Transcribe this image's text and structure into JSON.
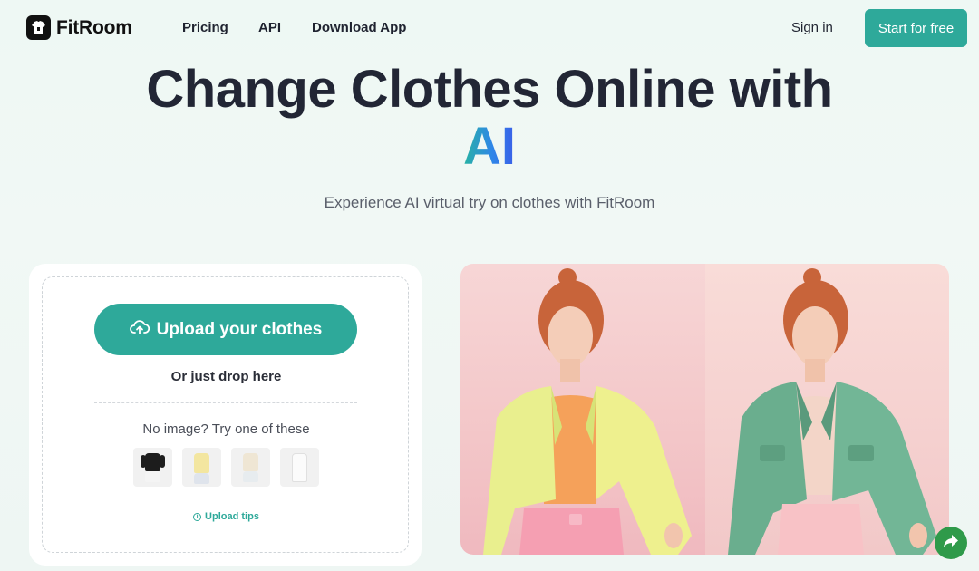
{
  "brand": {
    "name": "FitRoom"
  },
  "nav": {
    "links": [
      "Pricing",
      "API",
      "Download App"
    ],
    "sign_in": "Sign in",
    "cta": "Start for free"
  },
  "hero": {
    "title_line1": "Change Clothes Online with",
    "title_line2": "AI",
    "subtitle": "Experience AI virtual try on clothes with FitRoom"
  },
  "upload": {
    "button_label": "Upload your clothes",
    "drop_text": "Or just drop here",
    "samples_text": "No image? Try one of these",
    "samples": [
      "sample-black-top",
      "sample-yellow-top",
      "sample-cream-top",
      "sample-white-dress"
    ],
    "tips_label": "Upload tips"
  },
  "icons": {
    "logo": "shirt-logo-icon",
    "upload": "cloud-upload-icon",
    "tips": "info-icon",
    "share": "share-arrow-icon"
  },
  "colors": {
    "accent": "#2ea99a",
    "ai_gradient_start": "#27b3a3",
    "ai_gradient_end": "#3a5ee8",
    "share": "#2f9a4a"
  }
}
